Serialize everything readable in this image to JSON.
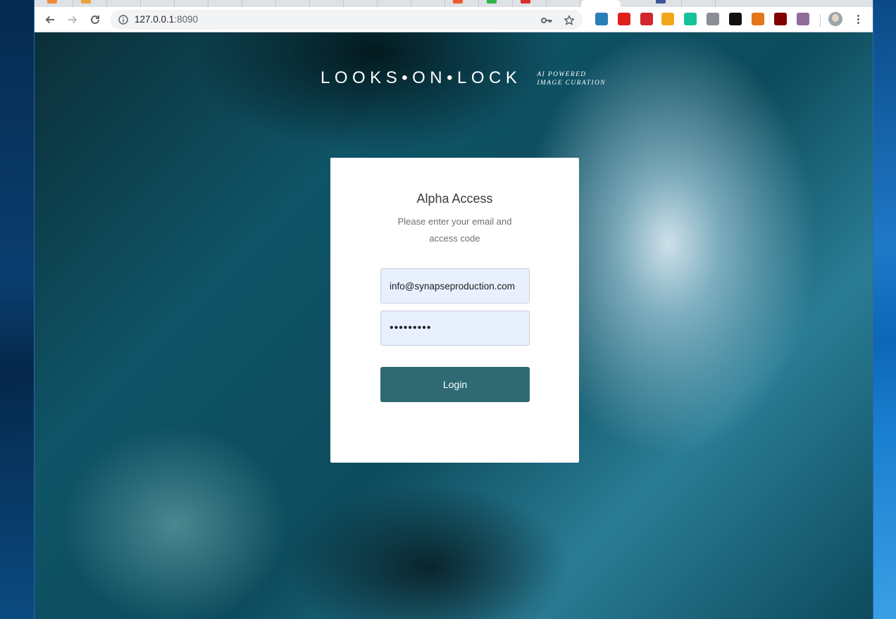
{
  "browser": {
    "url_host": "127.0.0.1",
    "url_port": ":8090",
    "icons": {
      "back": "arrow-left-icon",
      "forward": "arrow-right-icon",
      "reload": "reload-icon",
      "site_info": "info-icon",
      "password_key": "key-icon",
      "bookmark": "star-icon",
      "menu": "three-dots-icon"
    },
    "extensions": [
      {
        "name": "ext-1-icon",
        "color": "#2a7fb8"
      },
      {
        "name": "ext-2-icon",
        "color": "#e0201d"
      },
      {
        "name": "ext-3-icon",
        "color": "#d0262c"
      },
      {
        "name": "ext-4-icon",
        "color": "#f2a71b"
      },
      {
        "name": "grammarly-icon",
        "color": "#15c39a"
      },
      {
        "name": "ext-6-icon",
        "color": "#8a8f96"
      },
      {
        "name": "ext-7-icon",
        "color": "#101010"
      },
      {
        "name": "metamask-icon",
        "color": "#e2761b"
      },
      {
        "name": "ublock-icon",
        "color": "#800000"
      },
      {
        "name": "ext-10-icon",
        "color": "#8e6d9a"
      }
    ]
  },
  "brand": {
    "name": "LOOKS•ON•LOCK",
    "tagline_line1": "AI POWERED",
    "tagline_line2": "IMAGE CURATION"
  },
  "login": {
    "title": "Alpha Access",
    "subtitle": "Please enter your email and access code",
    "email_value": "info@synapseproduction.com",
    "password_value": "•••••••••",
    "button_label": "Login"
  }
}
